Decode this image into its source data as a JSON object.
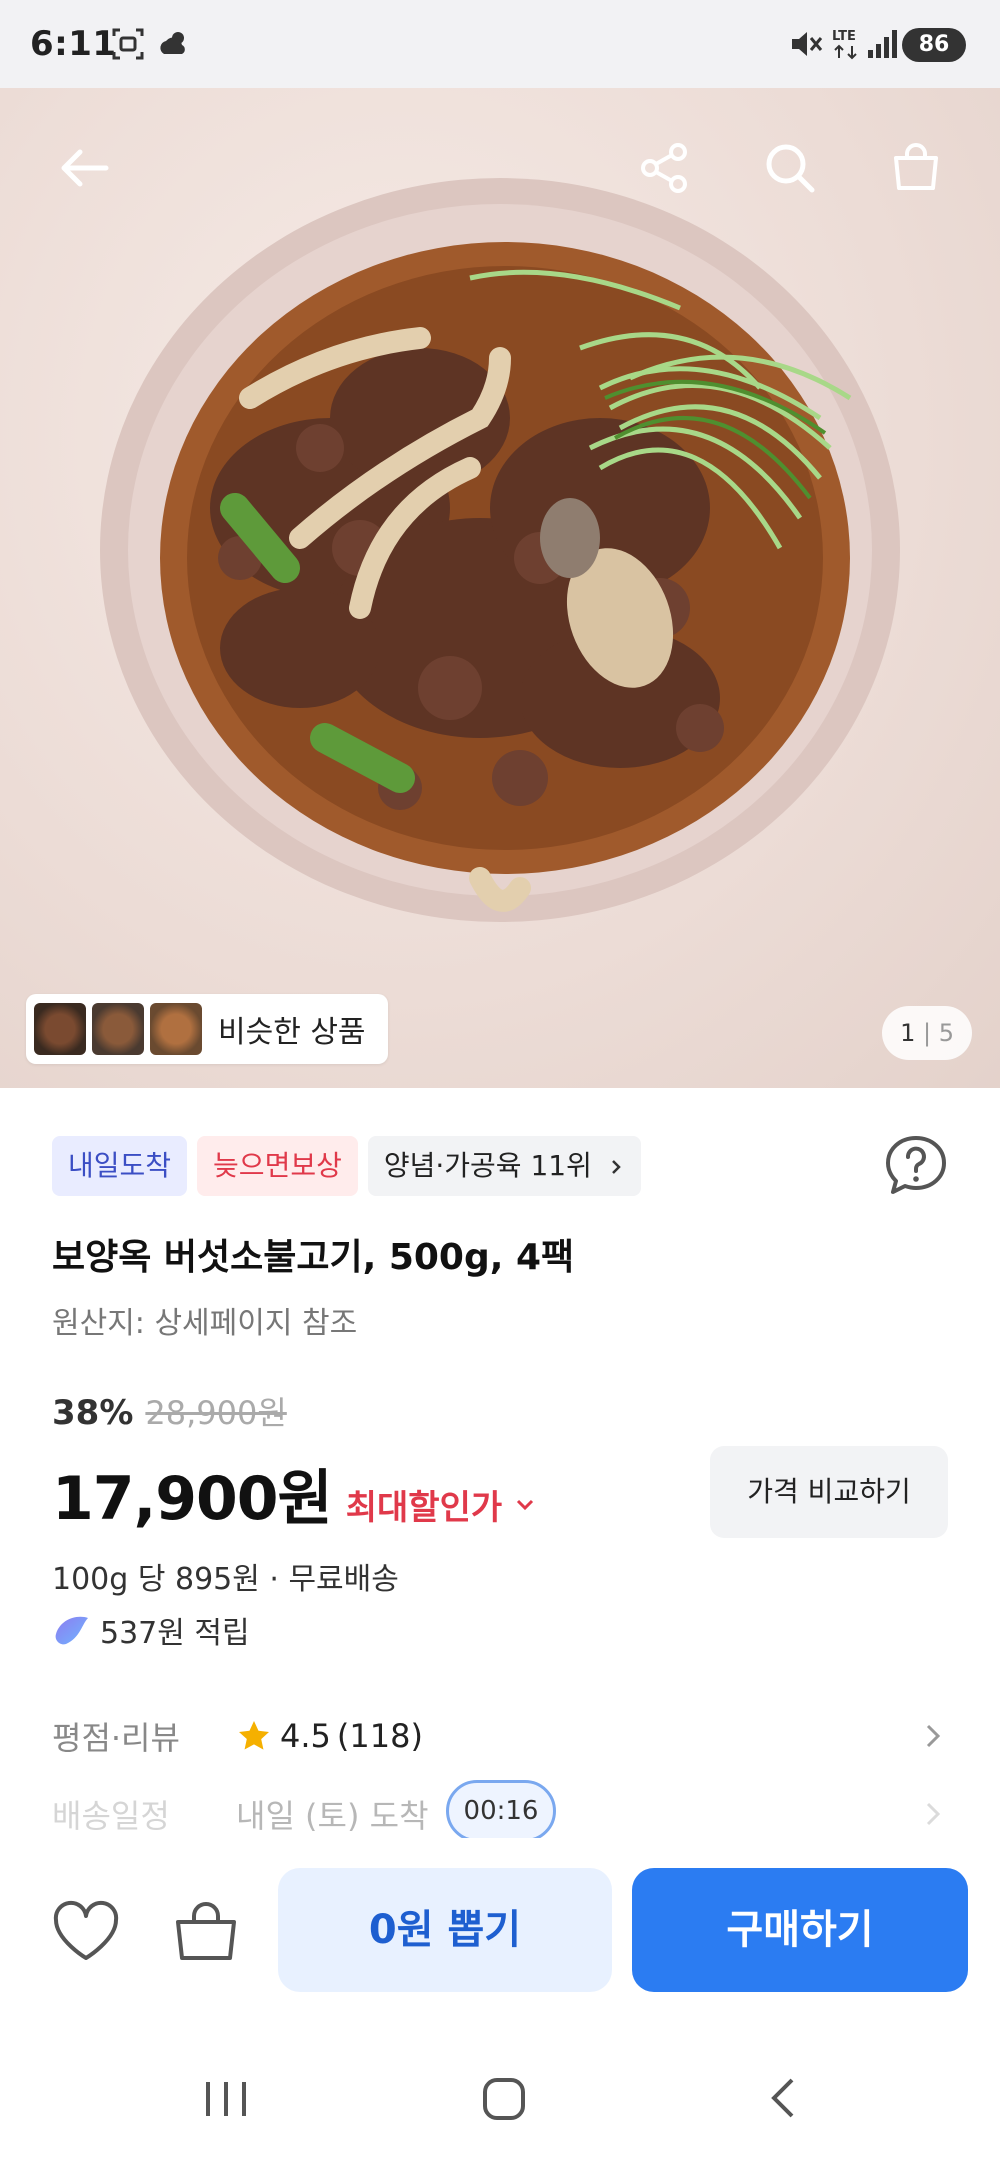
{
  "status_bar": {
    "time": "6:11",
    "battery": "86"
  },
  "hero": {
    "similar_label": "비슷한 상품",
    "pager_current": "1",
    "pager_total": "5"
  },
  "tags": [
    "내일도착",
    "늦으면보상",
    "양념·가공육 11위"
  ],
  "product": {
    "title": "보양옥 버섯소불고기, 500g, 4팩",
    "origin": "원산지: 상세페이지 참조",
    "discount": "38%",
    "original_price": "28,900원",
    "price": "17,900원",
    "max_discount_label": "최대할인가",
    "compare_label": "가격 비교하기",
    "unit_price": "100g 당 895원 · 무료배송",
    "points": "537원 적립"
  },
  "rating": {
    "label": "평점·리뷰",
    "score": "4.5",
    "count": "(118)"
  },
  "shipping": {
    "label": "배송일정",
    "value": "내일 (토) 도착"
  },
  "timer": "00:16",
  "actions": {
    "draw_label": "0원 뽑기",
    "buy_label": "구매하기"
  },
  "colors": {
    "accent": "#2b7cf2",
    "red": "#e0394a",
    "tag_blue": "#3b4ec4",
    "star": "#f5b000"
  }
}
